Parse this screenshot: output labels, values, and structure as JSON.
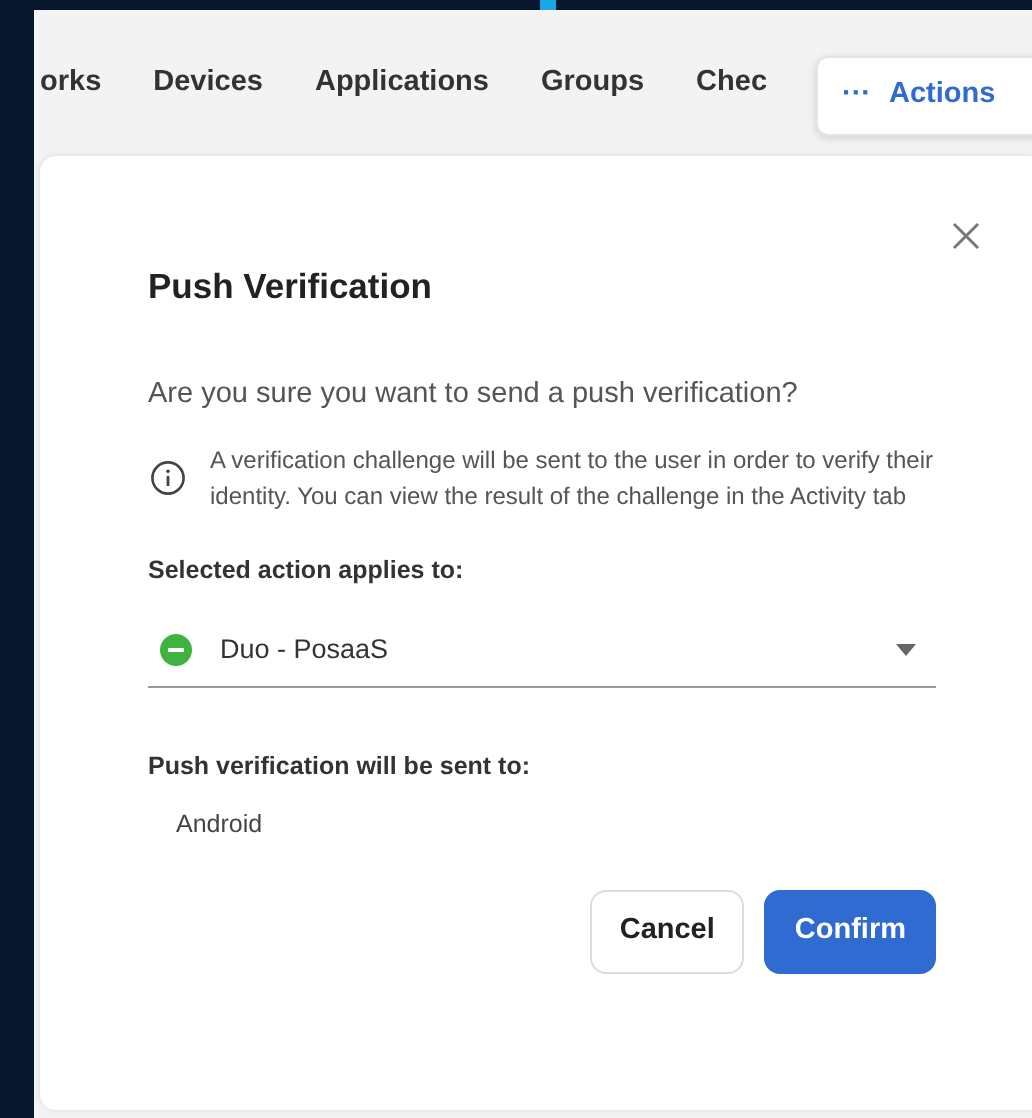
{
  "tabs": [
    {
      "label": "orks"
    },
    {
      "label": "Devices"
    },
    {
      "label": "Applications"
    },
    {
      "label": "Groups"
    },
    {
      "label": "Chec"
    }
  ],
  "actions_button": {
    "icon": "···",
    "label": "Actions"
  },
  "dialog": {
    "title": "Push Verification",
    "question": "Are you sure you want to send a push verification?",
    "info_note": "A verification challenge will be sent to the user in order to verify their identity. You can view the result of the challenge in the Activity tab",
    "applies_label": "Selected action applies to:",
    "selected_app": {
      "name": "Duo - PosaaS",
      "color": "#3fb33f"
    },
    "sent_to_label": "Push verification will be sent to:",
    "sent_to_value": "Android",
    "buttons": [
      {
        "label": "Cancel",
        "kind": "secondary"
      },
      {
        "label": "Confirm",
        "kind": "primary"
      }
    ]
  }
}
